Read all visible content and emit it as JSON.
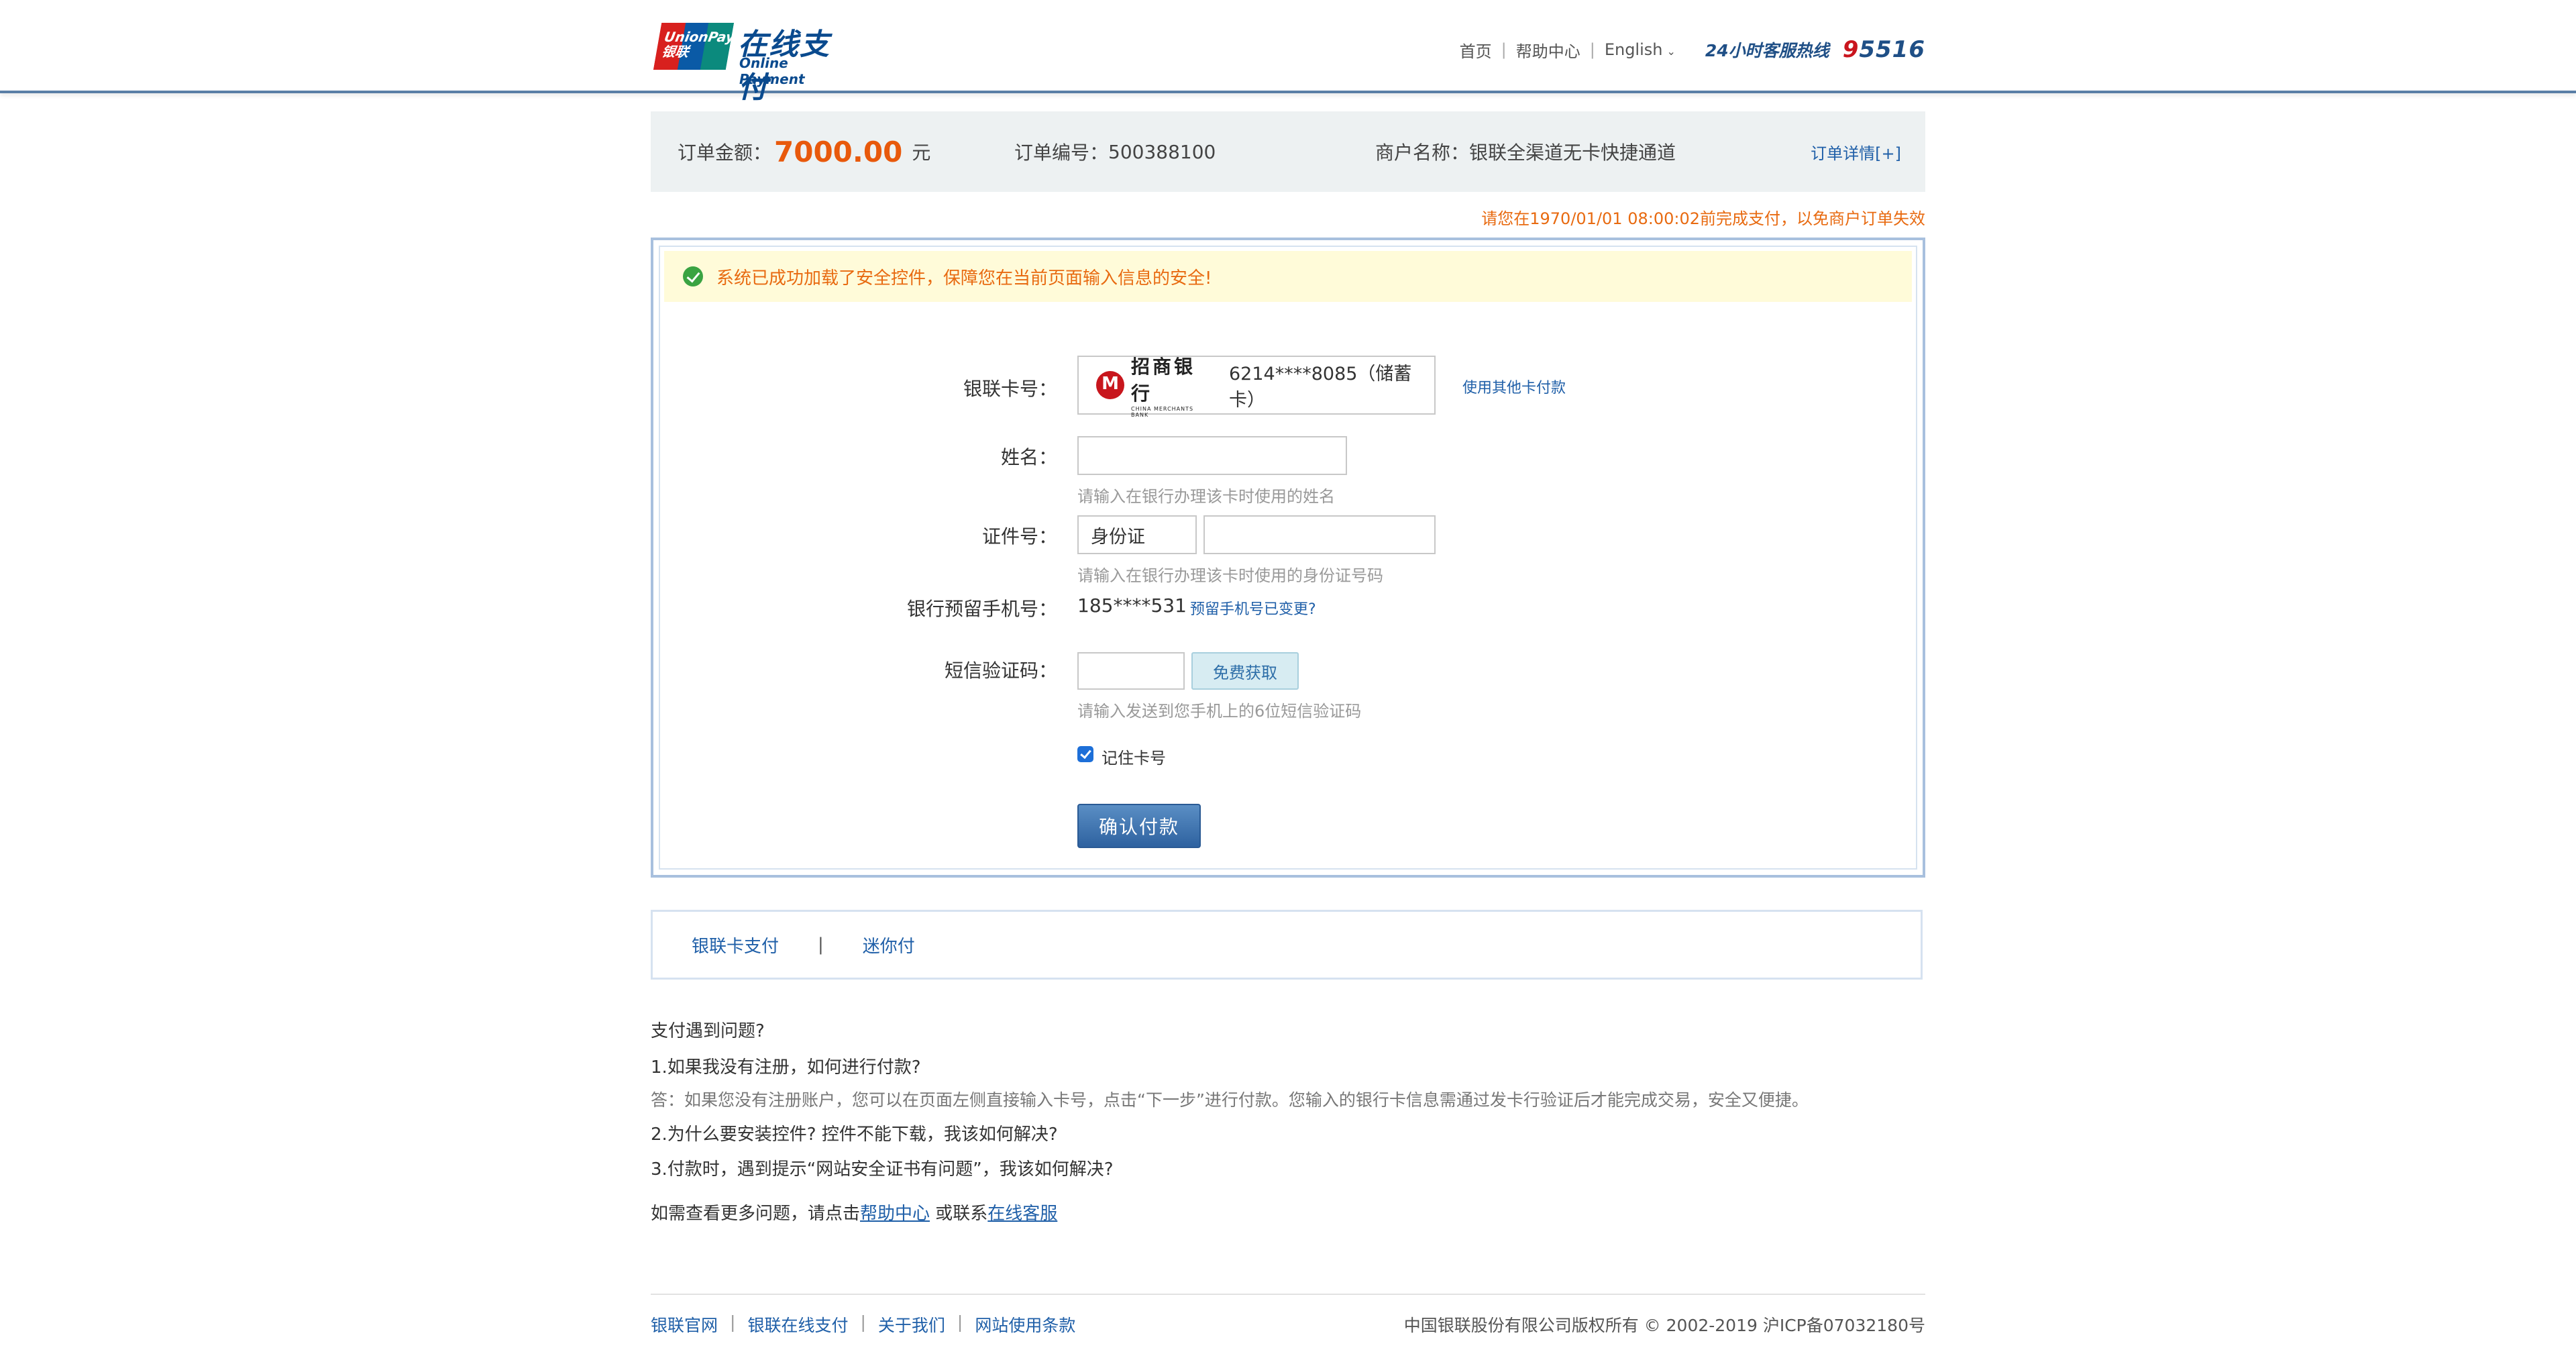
{
  "header": {
    "logo_badge": "UnionPay 银联",
    "logo_title": "在线支付",
    "logo_subtitle": "Online Payment",
    "nav": [
      "首页",
      "帮助中心"
    ],
    "language": "English",
    "hotline_label": "24小时客服热线",
    "hotline_prefix": "9",
    "hotline_rest": "5516"
  },
  "order": {
    "amount_label": "订单金额：",
    "amount_value": "7000.00",
    "amount_unit": "元",
    "number_label": "订单编号：",
    "number_value": "500388100",
    "merchant_label": "商户名称：",
    "merchant_value": "银联全渠道无卡快捷通道",
    "detail_link": "订单详情[+]",
    "deadline_text": "请您在1970/01/01 08:00:02前完成支付，以免商户订单失效"
  },
  "form": {
    "security_notice": "系统已成功加载了安全控件，保障您在当前页面输入信息的安全!",
    "card_label": "银联卡号：",
    "bank_name": "招商银行",
    "bank_name_en": "CHINA MERCHANTS BANK",
    "card_number": "6214****8085（储蓄卡）",
    "other_card_link": "使用其他卡付款",
    "name_label": "姓名：",
    "name_value": "",
    "name_hint": "请输入在银行办理该卡时使用的姓名",
    "id_label": "证件号：",
    "id_type": "身份证",
    "id_value": "",
    "id_hint": "请输入在银行办理该卡时使用的身份证号码",
    "phone_label": "银行预留手机号：",
    "phone_value": "185****531",
    "phone_changed_link": "预留手机号已变更?",
    "sms_label": "短信验证码：",
    "sms_value": "",
    "sms_button": "免费获取",
    "sms_hint": "请输入发送到您手机上的6位短信验证码",
    "remember_label": "记住卡号",
    "remember_checked": true,
    "confirm_button": "确认付款"
  },
  "methods": {
    "items": [
      "银联卡支付",
      "迷你付"
    ],
    "separator": "|"
  },
  "faq": {
    "title": "支付遇到问题?",
    "q1": "1.如果我没有注册，如何进行付款?",
    "a1": "答：如果您没有注册账户，您可以在页面左侧直接输入卡号，点击“下一步”进行付款。您输入的银行卡信息需通过发卡行验证后才能完成交易，安全又便捷。",
    "q2": "2.为什么要安装控件? 控件不能下载，我该如何解决?",
    "q3": "3.付款时，遇到提示“网站安全证书有问题”，我该如何解决?",
    "more_prefix": "如需查看更多问题，请点击",
    "help_link": "帮助中心",
    "more_middle": " 或联系",
    "service_link": "在线客服"
  },
  "footer": {
    "links": [
      "银联官网",
      "银联在线支付",
      "关于我们",
      "网站使用条款"
    ],
    "copyright": "中国银联股份有限公司版权所有 © 2002-2019 沪ICP备07032180号"
  },
  "colors": {
    "accent_orange": "#e8590c",
    "link_blue": "#1f5fa8",
    "brand_navy": "#1f4f86",
    "hotline_red": "#c9151e"
  }
}
